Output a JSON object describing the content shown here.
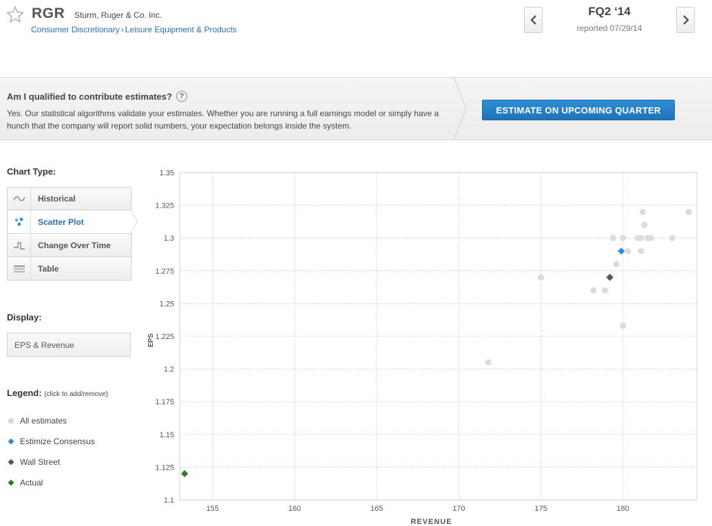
{
  "header": {
    "ticker": "RGR",
    "company": "Sturm, Ruger & Co. Inc.",
    "sector": "Consumer Discretionary",
    "breadcrumb_sep": "›",
    "industry": "Leisure Equipment & Products",
    "quarter": "FQ2 ‘14",
    "reported": "reported 07/29/14",
    "prev_icon": "chevron-left-icon",
    "next_icon": "chevron-right-icon"
  },
  "banner": {
    "question": "Am I qualified to contribute estimates?",
    "help_glyph": "?",
    "answer": "Yes. Our statistical algorithms validate your estimates. Whether you are running a full earnings model or simply have a hunch that the company will report solid numbers, your expectation belongs inside the system.",
    "button_label": "ESTIMATE ON UPCOMING QUARTER"
  },
  "sidebar": {
    "chart_type_label": "Chart Type:",
    "chart_types": [
      {
        "label": "Historical",
        "icon": "wave-icon",
        "active": false
      },
      {
        "label": "Scatter Plot",
        "icon": "scatter-icon",
        "active": true
      },
      {
        "label": "Change Over Time",
        "icon": "step-icon",
        "active": false
      },
      {
        "label": "Table",
        "icon": "table-icon",
        "active": false
      }
    ],
    "display_label": "Display:",
    "display_value": "EPS & Revenue",
    "legend_label": "Legend:",
    "legend_hint": "(click to add/remove)",
    "legend": [
      {
        "label": "All estimates",
        "color": "#d8d8d8",
        "shape": "circle"
      },
      {
        "label": "Estimize Consensus",
        "color": "#2d8fe0",
        "shape": "diamond"
      },
      {
        "label": "Wall Street",
        "color": "#555555",
        "shape": "diamond"
      },
      {
        "label": "Actual",
        "color": "#2e7d1e",
        "shape": "diamond"
      }
    ]
  },
  "chart_data": {
    "type": "scatter",
    "xlabel": "REVENUE",
    "ylabel": "EPS",
    "xlim": [
      153,
      184.5
    ],
    "ylim": [
      1.1,
      1.35
    ],
    "x_ticks": [
      155,
      160,
      165,
      170,
      175,
      180
    ],
    "y_ticks": [
      1.1,
      1.125,
      1.15,
      1.175,
      1.2,
      1.225,
      1.25,
      1.275,
      1.3,
      1.325,
      1.35
    ],
    "y_tick_labels": [
      "1.1",
      "1.125",
      "1.15",
      "1.175",
      "1.2",
      "1.225",
      "1.25",
      "1.275",
      "1.3",
      "1.325",
      "1.35"
    ],
    "x_tick_labels": [
      "155",
      "160",
      "165",
      "170",
      "175",
      "180"
    ],
    "grid": true,
    "series": [
      {
        "name": "All estimates",
        "color": "#dcdcdc",
        "shape": "circle",
        "points": [
          [
            171.8,
            1.205
          ],
          [
            175.0,
            1.27
          ],
          [
            178.2,
            1.26
          ],
          [
            178.9,
            1.26
          ],
          [
            179.6,
            1.28
          ],
          [
            179.4,
            1.3
          ],
          [
            180.0,
            1.3
          ],
          [
            180.3,
            1.29
          ],
          [
            180.0,
            1.233
          ],
          [
            180.9,
            1.3
          ],
          [
            181.1,
            1.3
          ],
          [
            181.1,
            1.29
          ],
          [
            181.2,
            1.32
          ],
          [
            181.3,
            1.31
          ],
          [
            181.5,
            1.3
          ],
          [
            181.7,
            1.3
          ],
          [
            183.0,
            1.3
          ],
          [
            184.0,
            1.32
          ]
        ]
      },
      {
        "name": "Estimize Consensus",
        "color": "#2d8fe0",
        "shape": "diamond",
        "points": [
          [
            179.9,
            1.29
          ]
        ]
      },
      {
        "name": "Wall Street",
        "color": "#555555",
        "shape": "diamond",
        "points": [
          [
            179.2,
            1.27
          ]
        ]
      },
      {
        "name": "Actual",
        "color": "#2e7d1e",
        "shape": "diamond",
        "points": [
          [
            153.3,
            1.12
          ]
        ]
      }
    ]
  }
}
